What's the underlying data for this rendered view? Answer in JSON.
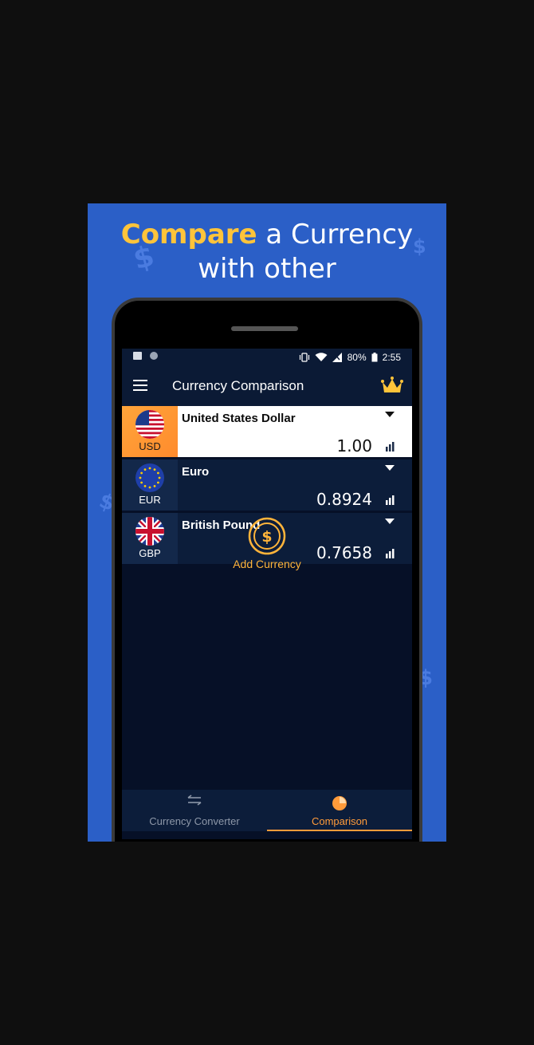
{
  "promo": {
    "headline_highlight": "Compare",
    "headline_rest_line1": " a Currency",
    "headline_line2": "with other"
  },
  "statusbar": {
    "battery": "80%",
    "time": "2:55"
  },
  "toolbar": {
    "title": "Currency Comparison"
  },
  "currencies": [
    {
      "code": "USD",
      "name": "United States Dollar",
      "amount": "1.00",
      "active": true
    },
    {
      "code": "EUR",
      "name": "Euro",
      "amount": "0.8924",
      "active": false
    },
    {
      "code": "GBP",
      "name": "British Pound",
      "amount": "0.7658",
      "active": false
    }
  ],
  "add_currency": {
    "label": "Add Currency"
  },
  "bottom_nav": {
    "tabs": [
      {
        "label": "Currency Converter",
        "active": false
      },
      {
        "label": "Comparison",
        "active": true
      }
    ]
  },
  "colors": {
    "promo_bg": "#2b5fc7",
    "highlight": "#ffc43a",
    "accent_orange": "#ff9b3a",
    "screen_bg": "#061027"
  }
}
